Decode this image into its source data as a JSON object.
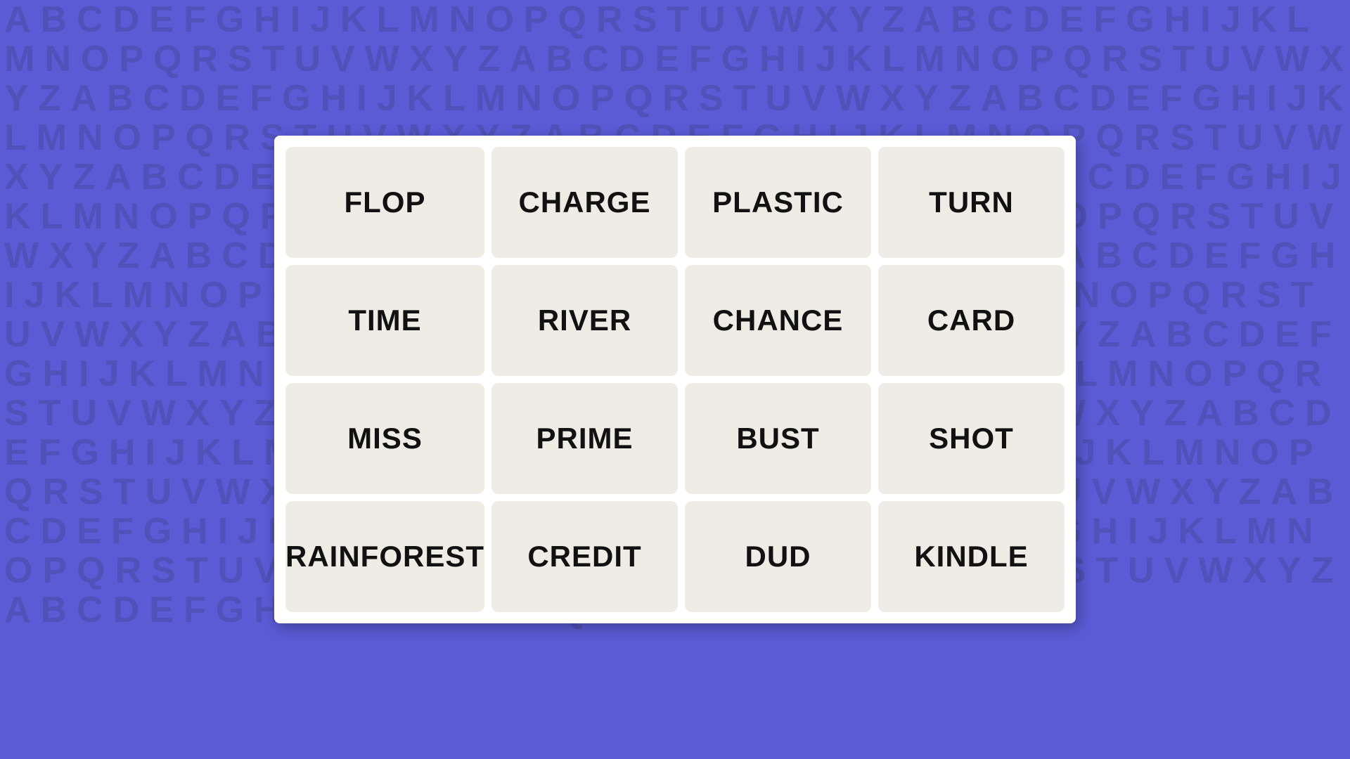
{
  "background": {
    "color": "#5b5bd6",
    "alphabet": "ABCDEFGHIJKLMNOPQRSTUVWXYZ"
  },
  "grid": {
    "words": [
      {
        "id": "flop",
        "label": "FLOP"
      },
      {
        "id": "charge",
        "label": "CHARGE"
      },
      {
        "id": "plastic",
        "label": "PLASTIC"
      },
      {
        "id": "turn",
        "label": "TURN"
      },
      {
        "id": "time",
        "label": "TIME"
      },
      {
        "id": "river",
        "label": "RIVER"
      },
      {
        "id": "chance",
        "label": "CHANCE"
      },
      {
        "id": "card",
        "label": "CARD"
      },
      {
        "id": "miss",
        "label": "MISS"
      },
      {
        "id": "prime",
        "label": "PRIME"
      },
      {
        "id": "bust",
        "label": "BUST"
      },
      {
        "id": "shot",
        "label": "SHOT"
      },
      {
        "id": "rainforest",
        "label": "RAINFOREST"
      },
      {
        "id": "credit",
        "label": "CREDIT"
      },
      {
        "id": "dud",
        "label": "DUD"
      },
      {
        "id": "kindle",
        "label": "KINDLE"
      }
    ]
  }
}
